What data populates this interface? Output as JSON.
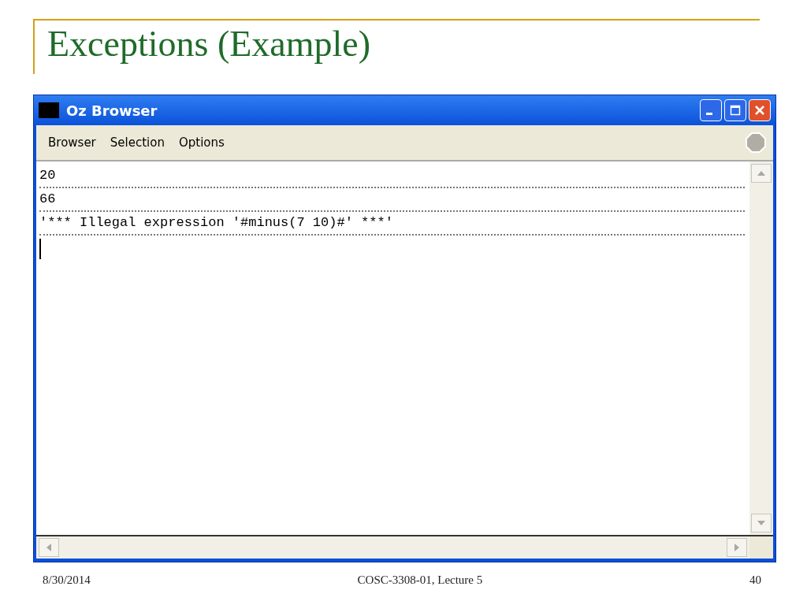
{
  "slide": {
    "title": "Exceptions (Example)"
  },
  "window": {
    "title": "Oz Browser",
    "menu": [
      "Browser",
      "Selection",
      "Options"
    ],
    "lines": [
      "20",
      "66",
      "'*** Illegal expression '#minus(7 10)#' ***'"
    ]
  },
  "footer": {
    "date": "8/30/2014",
    "course": "COSC-3308-01, Lecture 5",
    "page": "40"
  }
}
